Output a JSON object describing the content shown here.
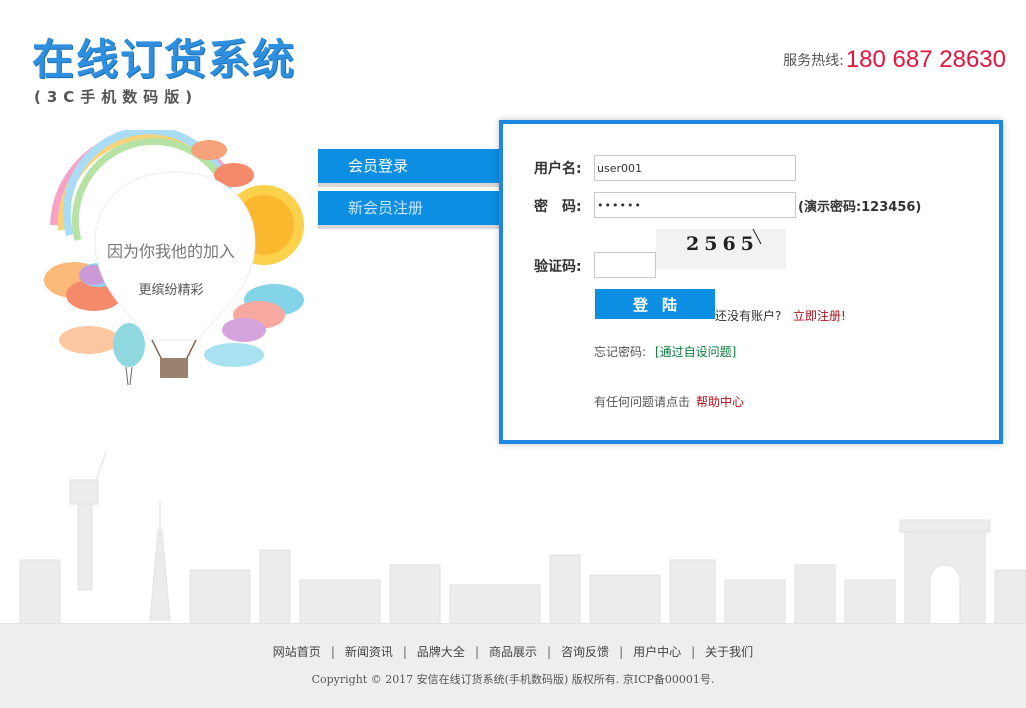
{
  "header": {
    "logo_title": "在线订货系统",
    "logo_subtitle": "(3C手机数码版)",
    "hotline_label": "服务热线:",
    "hotline_number": "180 687 28630"
  },
  "illustration": {
    "line1": "因为你我他的加入",
    "line2": "更缤纷精彩"
  },
  "tabs": {
    "login": "会员登录",
    "register": "新会员注册"
  },
  "form": {
    "username_label": "用户名:",
    "username_value": "user001",
    "password_label": "密　码:",
    "password_value": "123456",
    "password_hint": "(演示密码:123456)",
    "captcha_label": "验证码:",
    "captcha_value": "",
    "captcha_text": "2565",
    "login_button": "登陆",
    "no_account": "还没有账户?",
    "register_link": "立即注册!",
    "forgot_label": "忘记密码:",
    "forgot_link": "[通过自设问题]",
    "help_text": "有任何问题请点击",
    "help_link": "帮助中心"
  },
  "footer": {
    "nav": [
      "网站首页",
      "新闻资讯",
      "品牌大全",
      "商品展示",
      "咨询反馈",
      "用户中心",
      "关于我们"
    ],
    "copyright": "Copyright © 2017 安信在线订货系统(手机数码版) 版权所有. 京ICP备00001号."
  },
  "colors": {
    "brand_blue": "#0c8fe3",
    "panel_border": "#1e88de",
    "hotline_red": "#e8143c",
    "link_red": "#b0101a",
    "link_green": "#0a7d3b"
  }
}
